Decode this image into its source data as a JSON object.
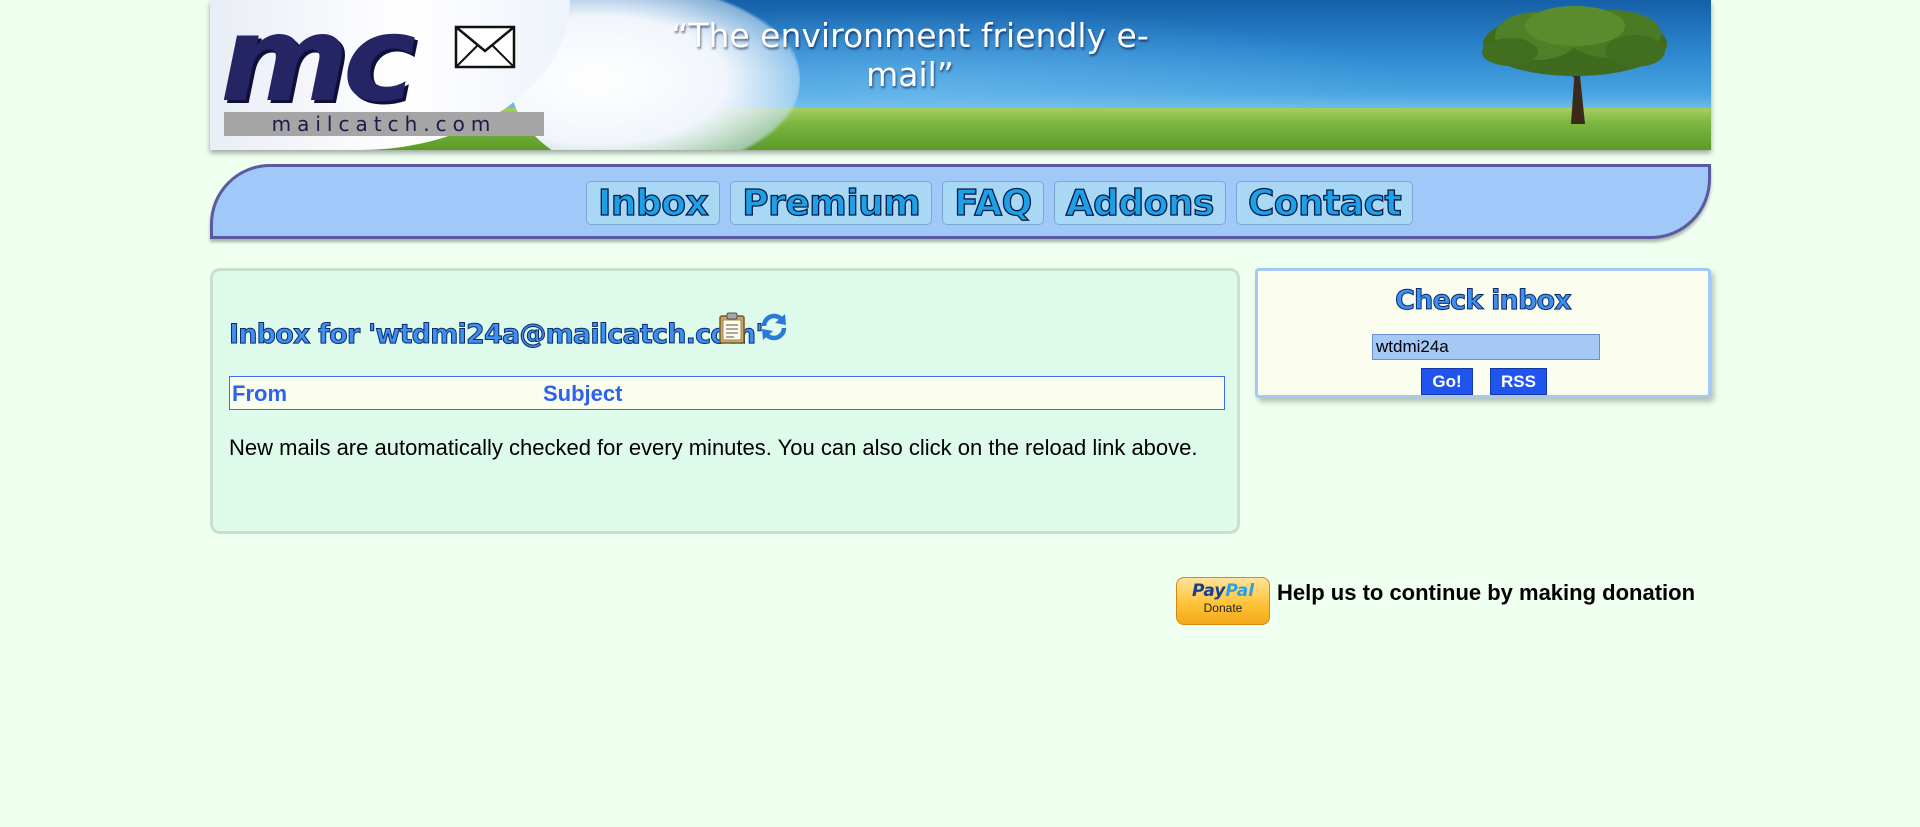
{
  "banner": {
    "logo_letters": "mc",
    "logo_domain": "mailcatch.com",
    "tagline": "“The environment friendly e-mail”"
  },
  "nav": {
    "items": [
      {
        "label": "Inbox"
      },
      {
        "label": "Premium"
      },
      {
        "label": "FAQ"
      },
      {
        "label": "Addons"
      },
      {
        "label": "Contact"
      }
    ]
  },
  "inbox": {
    "title": "Inbox for 'wtdmi24a@mailcatch.com'",
    "columns": [
      "From",
      "Subject"
    ],
    "notice": "New mails are automatically checked for every minutes. You can also click on the reload link above.",
    "icons": [
      "copy-to-clipboard-icon",
      "reload-icon"
    ]
  },
  "check_inbox": {
    "title": "Check inbox",
    "input_value": "wtdmi24a",
    "go_label": "Go!",
    "rss_label": "RSS"
  },
  "donation": {
    "paypal_word1": "Pay",
    "paypal_word2": "Pal",
    "paypal_button_label": "Donate",
    "text": "Help us to continue by making donation"
  },
  "colors": {
    "page_background": "#effff0",
    "nav_background": "#a0c8f8",
    "heading_blue": "#3d8ff0",
    "button_blue": "#1f54ee"
  }
}
